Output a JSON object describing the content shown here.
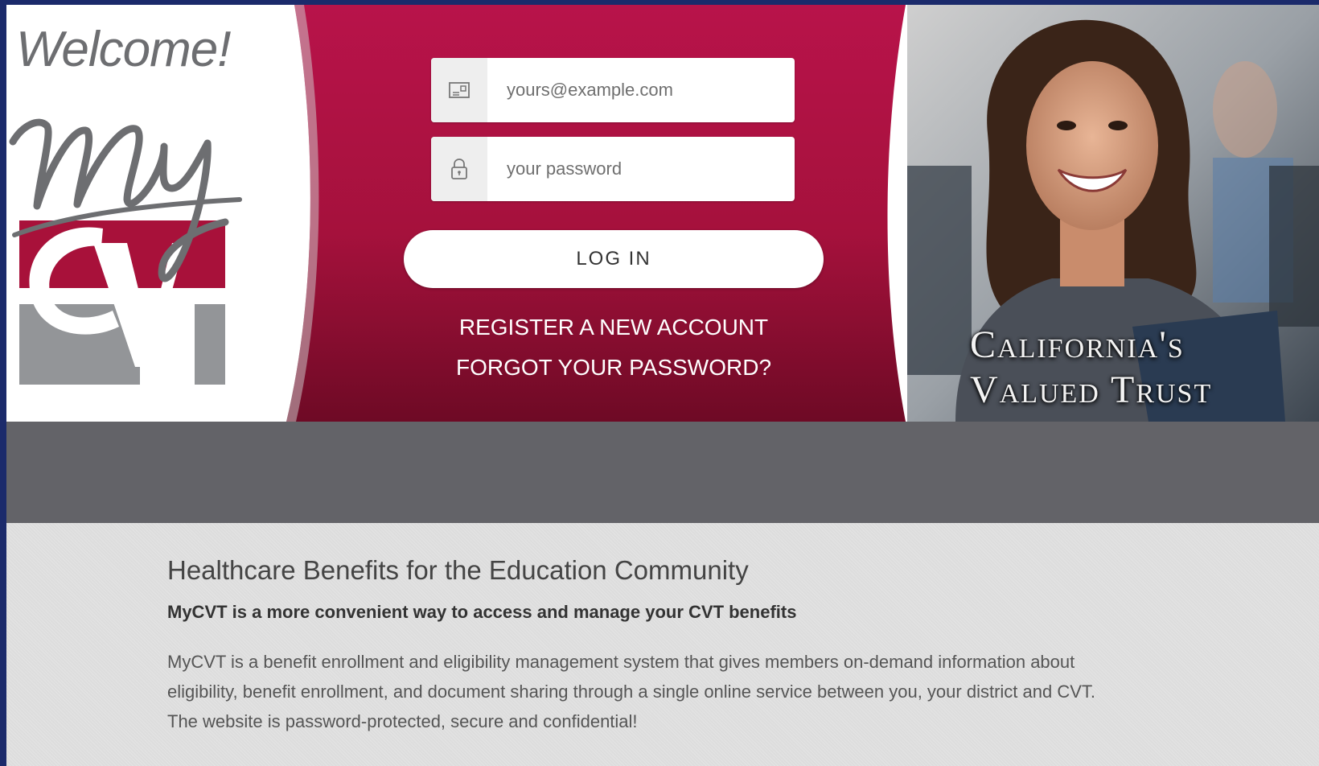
{
  "hero": {
    "welcome": "Welcome!",
    "logo_alt": "MyCVT",
    "tagline_line1": "California's",
    "tagline_line2": "Valued Trust"
  },
  "login": {
    "email_placeholder": "yours@example.com",
    "email_icon": "id-card-icon",
    "password_placeholder": "your password",
    "password_icon": "lock-icon",
    "login_label": "LOG IN",
    "register_label": "REGISTER A NEW ACCOUNT",
    "forgot_label": "FORGOT YOUR PASSWORD?"
  },
  "content": {
    "heading": "Healthcare Benefits for the Education Community",
    "subheading": "MyCVT is a more convenient way to access and manage your CVT benefits",
    "paragraph": "MyCVT is a benefit enrollment and eligibility management system that gives members on-demand information about eligibility, benefit enrollment, and document sharing through a single online service between you, your district and CVT. The website is password-protected, secure and confidential!"
  },
  "colors": {
    "brand_red": "#a8113a",
    "brand_gray": "#6d6e71",
    "top_bar": "#1b2a6b",
    "band_gray": "#636368"
  }
}
